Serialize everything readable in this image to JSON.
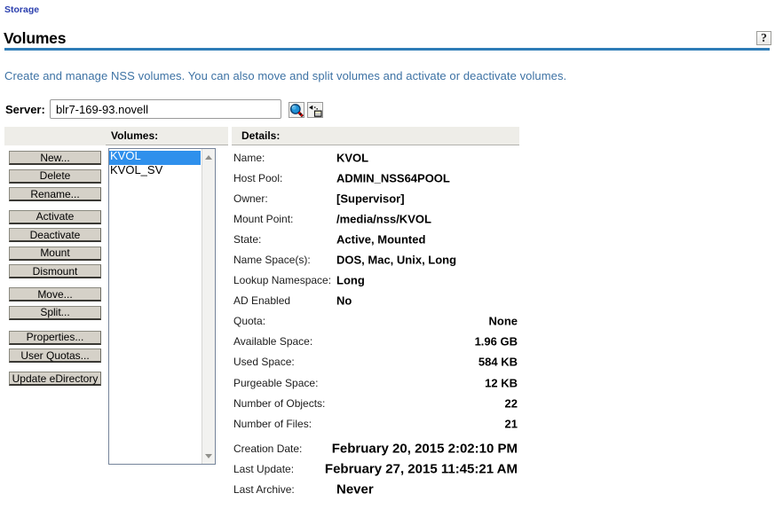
{
  "breadcrumb": {
    "label": "Storage"
  },
  "page": {
    "title": "Volumes",
    "description": "Create and manage NSS volumes. You can also move and split volumes and activate or deactivate volumes.",
    "help_label": "?"
  },
  "server": {
    "label": "Server:",
    "value": "blr7-169-93.novell",
    "icons": {
      "search": "object-selector-magnifier",
      "history": "object-history"
    }
  },
  "panel": {
    "volumes_header": "Volumes:",
    "details_header": "Details:",
    "button_groups": [
      [
        "New...",
        "Delete",
        "Rename..."
      ],
      [
        "Activate",
        "Deactivate",
        "Mount",
        "Dismount"
      ],
      [
        "Move...",
        "Split..."
      ],
      [
        "Properties...",
        "User Quotas..."
      ],
      [
        "Update eDirectory"
      ]
    ],
    "volumes": [
      {
        "name": "KVOL",
        "selected": true
      },
      {
        "name": "KVOL_SV",
        "selected": false
      }
    ],
    "details": [
      {
        "label": "Name:",
        "value": "KVOL",
        "align": "left"
      },
      {
        "label": "Host Pool:",
        "value": "ADMIN_NSS64POOL",
        "align": "left"
      },
      {
        "label": "Owner:",
        "value": "[Supervisor]",
        "align": "left"
      },
      {
        "label": "Mount Point:",
        "value": "/media/nss/KVOL",
        "align": "left"
      },
      {
        "label": "State:",
        "value": "Active, Mounted",
        "align": "left"
      },
      {
        "label": "Name Space(s):",
        "value": "DOS, Mac, Unix, Long",
        "align": "left"
      },
      {
        "label": "Lookup Namespace:",
        "value": "Long",
        "align": "left"
      },
      {
        "label": "AD Enabled",
        "value": "No",
        "align": "left"
      },
      {
        "label": "Quota:",
        "value": "None",
        "align": "right"
      },
      {
        "label": "Available Space:",
        "value": "1.96 GB",
        "align": "right"
      },
      {
        "label": "Used Space:",
        "value": "584 KB",
        "align": "right"
      },
      {
        "label": "Purgeable Space:",
        "value": "12 KB",
        "align": "right"
      },
      {
        "label": "Number of Objects:",
        "value": "22",
        "align": "right"
      },
      {
        "label": "Number of Files:",
        "value": "21",
        "align": "right"
      },
      {
        "label": "Creation Date:",
        "value": "February 20, 2015 2:02:10 PM",
        "align": "right",
        "large": true,
        "gap": true
      },
      {
        "label": "Last Update:",
        "value": "February 27, 2015 11:45:21 AM",
        "align": "right",
        "large": true
      },
      {
        "label": "Last Archive:",
        "value": "Never",
        "align": "left",
        "large": true
      }
    ]
  },
  "colors": {
    "accent_rule": "#2e7cb7",
    "breadcrumb_link": "#2b3fae",
    "description_text": "#3d72a4",
    "band_background": "#eeede8",
    "button_face": "#d5d1c8",
    "selection_background": "#2f90ec",
    "selection_text": "#ffffff"
  }
}
